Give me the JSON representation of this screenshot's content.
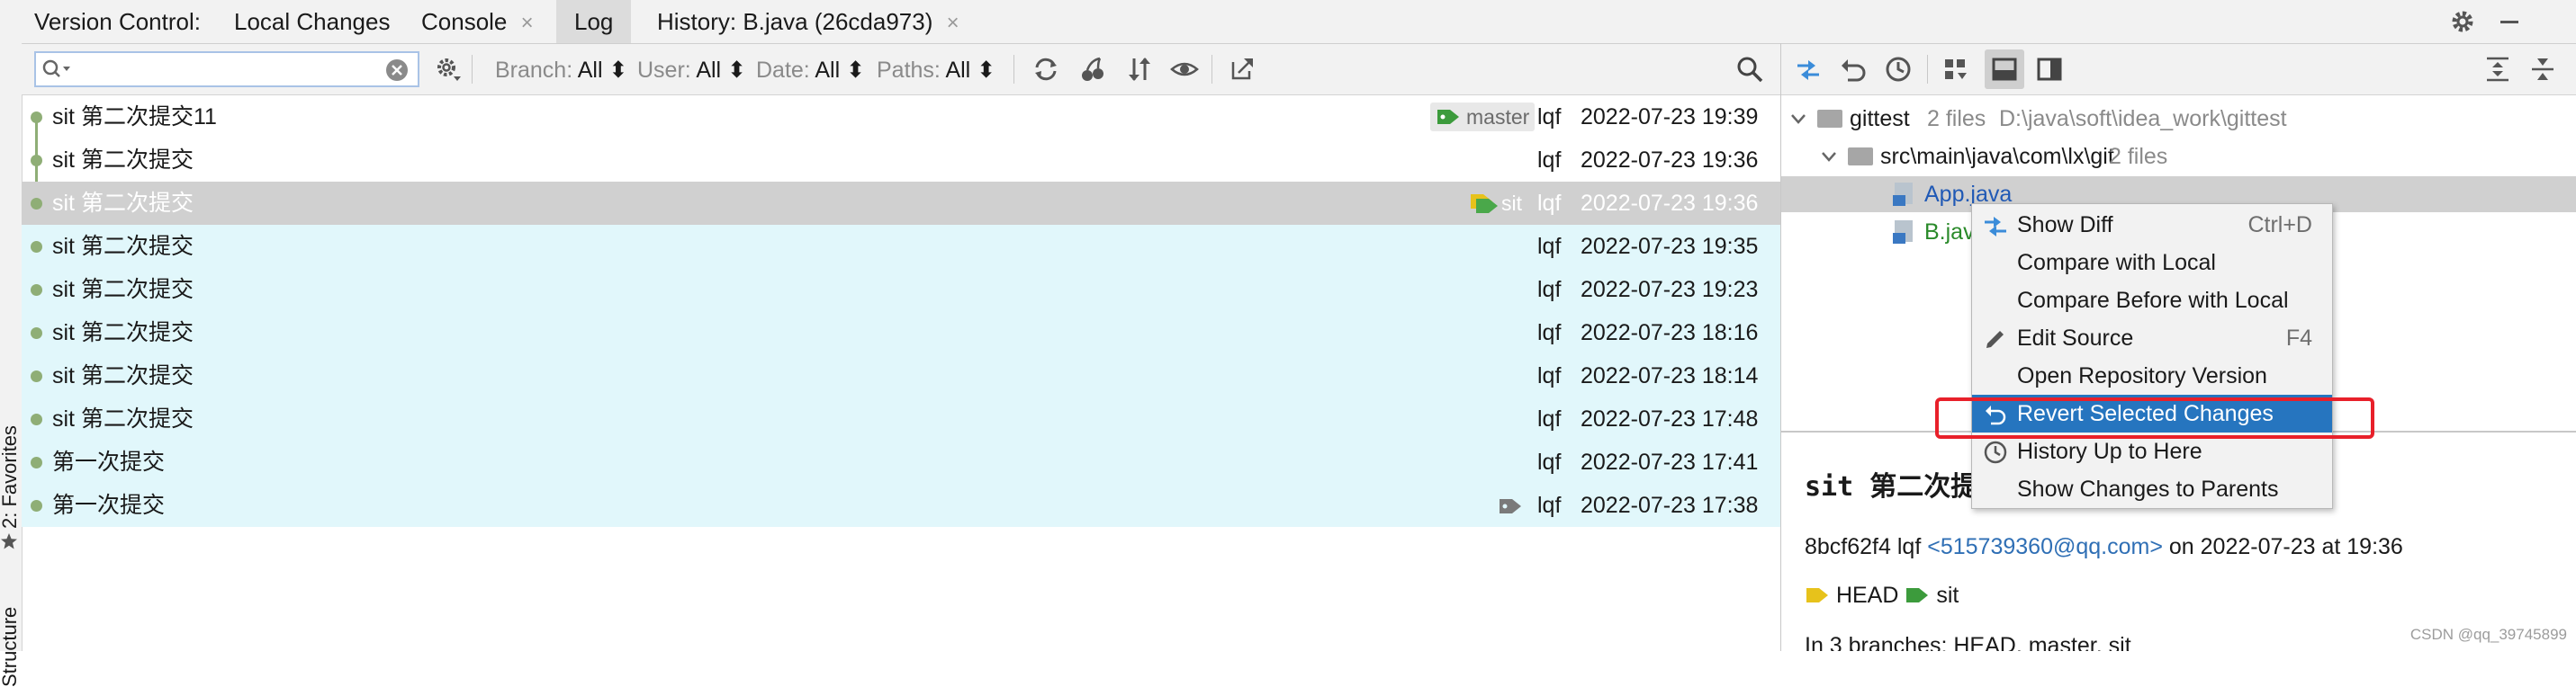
{
  "tabbar": {
    "title": "Version Control:",
    "tabs": [
      {
        "label": "Local Changes",
        "closable": false,
        "active": false
      },
      {
        "label": "Console",
        "closable": true,
        "active": false
      },
      {
        "label": "Log",
        "closable": false,
        "active": true
      },
      {
        "label": "History: B.java (26cda973)",
        "closable": true,
        "active": false
      }
    ],
    "close_glyph": "×"
  },
  "left_stripe": {
    "favorites_label": "2: Favorites",
    "structure_label": "Structure"
  },
  "log_toolbar": {
    "search_value": "",
    "filters": [
      {
        "name": "Branch:",
        "value": "All"
      },
      {
        "name": "User:",
        "value": "All"
      },
      {
        "name": "Date:",
        "value": "All"
      },
      {
        "name": "Paths:",
        "value": "All"
      }
    ],
    "dropdown_glyph": "⬍"
  },
  "commits": [
    {
      "message": "sit 第二次提交11",
      "author": "lqf",
      "date": "2022-07-23 19:39",
      "tag": "master",
      "state": "normal"
    },
    {
      "message": "sit 第二次提交",
      "author": "lqf",
      "date": "2022-07-23 19:36",
      "tag": "",
      "state": "normal"
    },
    {
      "message": "sit 第二次提交",
      "author": "lqf",
      "date": "2022-07-23 19:36",
      "tag": "sit",
      "state": "selected"
    },
    {
      "message": "sit 第二次提交",
      "author": "lqf",
      "date": "2022-07-23 19:35",
      "tag": "",
      "state": "highlight"
    },
    {
      "message": "sit 第二次提交",
      "author": "lqf",
      "date": "2022-07-23 19:23",
      "tag": "",
      "state": "highlight"
    },
    {
      "message": "sit 第二次提交",
      "author": "lqf",
      "date": "2022-07-23 18:16",
      "tag": "",
      "state": "highlight"
    },
    {
      "message": "sit 第二次提交",
      "author": "lqf",
      "date": "2022-07-23 18:14",
      "tag": "",
      "state": "highlight"
    },
    {
      "message": "sit 第二次提交",
      "author": "lqf",
      "date": "2022-07-23 17:48",
      "tag": "",
      "state": "highlight"
    },
    {
      "message": "第一次提交",
      "author": "lqf",
      "date": "2022-07-23 17:41",
      "tag": "",
      "state": "highlight"
    },
    {
      "message": "第一次提交",
      "author": "lqf",
      "date": "2022-07-23 17:38",
      "tag": "tag-icon-only",
      "state": "highlight"
    }
  ],
  "changes_tree": {
    "root": {
      "name": "gittest",
      "count": "2 files",
      "path": "D:\\java\\soft\\idea_work\\gittest"
    },
    "package": {
      "name": "src\\main\\java\\com\\lx\\git",
      "count": "2 files"
    },
    "files": [
      {
        "name": "App.java",
        "color": "#2059b5"
      },
      {
        "name": "B.java",
        "color": "#2a8a2a"
      }
    ]
  },
  "details": {
    "subject": "sit 第二次提",
    "hash": "8bcf62f4",
    "author": "lqf",
    "email": "<515739360@qq.com>",
    "on_text": "on 2022-07-23 at 19:36",
    "refs": [
      "HEAD",
      "sit"
    ],
    "branches_text": "In 3 branches: HEAD, master, sit"
  },
  "context_menu": {
    "items": [
      {
        "label": "Show Diff",
        "shortcut": "Ctrl+D",
        "icon": "diff-icon",
        "highlighted": false
      },
      {
        "label": "Compare with Local",
        "shortcut": "",
        "icon": "",
        "highlighted": false
      },
      {
        "label": "Compare Before with Local",
        "shortcut": "",
        "icon": "",
        "highlighted": false
      },
      {
        "label": "Edit Source",
        "shortcut": "F4",
        "icon": "pencil-icon",
        "highlighted": false
      },
      {
        "label": "Open Repository Version",
        "shortcut": "",
        "icon": "",
        "highlighted": false
      },
      {
        "label": "Revert Selected Changes",
        "shortcut": "",
        "icon": "revert-icon",
        "highlighted": true
      },
      {
        "label": "History Up to Here",
        "shortcut": "",
        "icon": "history-icon",
        "highlighted": false
      },
      {
        "label": "Show Changes to Parents",
        "shortcut": "",
        "icon": "",
        "highlighted": false
      }
    ]
  },
  "colors": {
    "accent_blue": "#2675bf",
    "selection_gray": "#d0d0d0",
    "highlight_cyan": "#e1f7fb",
    "graph_green": "#8fae76",
    "annotation_red": "#e8202a"
  },
  "watermark": "CSDN @qq_39745899"
}
